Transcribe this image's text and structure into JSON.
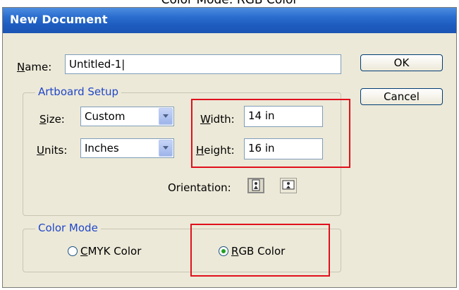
{
  "caption": "Color Mode: RGB Color",
  "dialog": {
    "title": "New Document",
    "name_label_hotkey": "N",
    "name_label_rest": "ame:",
    "name_value": "Untitled-1",
    "ok_label": "OK",
    "cancel_label": "Cancel"
  },
  "artboard": {
    "legend": "Artboard Setup",
    "size_label_hotkey": "S",
    "size_label_rest": "ize:",
    "size_value": "Custom",
    "units_label_hotkey": "U",
    "units_label_rest": "nits:",
    "units_value": "Inches",
    "width_label_hotkey": "W",
    "width_label_rest": "idth:",
    "width_value": "14 in",
    "height_label_hotkey": "H",
    "height_label_rest": "eight:",
    "height_value": "16 in",
    "orientation_label": "Orientation:"
  },
  "color_mode": {
    "legend": "Color Mode",
    "cmyk_hotkey": "C",
    "cmyk_rest": "MYK Color",
    "rgb_hotkey": "R",
    "rgb_rest": "GB Color",
    "selected": "RGB"
  },
  "icons": {
    "dropdown": "chevron-down-icon",
    "portrait": "portrait-orientation-icon",
    "landscape": "landscape-orientation-icon"
  },
  "colors": {
    "title_bar": "#1d5bbf",
    "dialog_bg": "#ece9d8",
    "legend_text": "#2147c8",
    "highlight_box": "#e0101c"
  }
}
